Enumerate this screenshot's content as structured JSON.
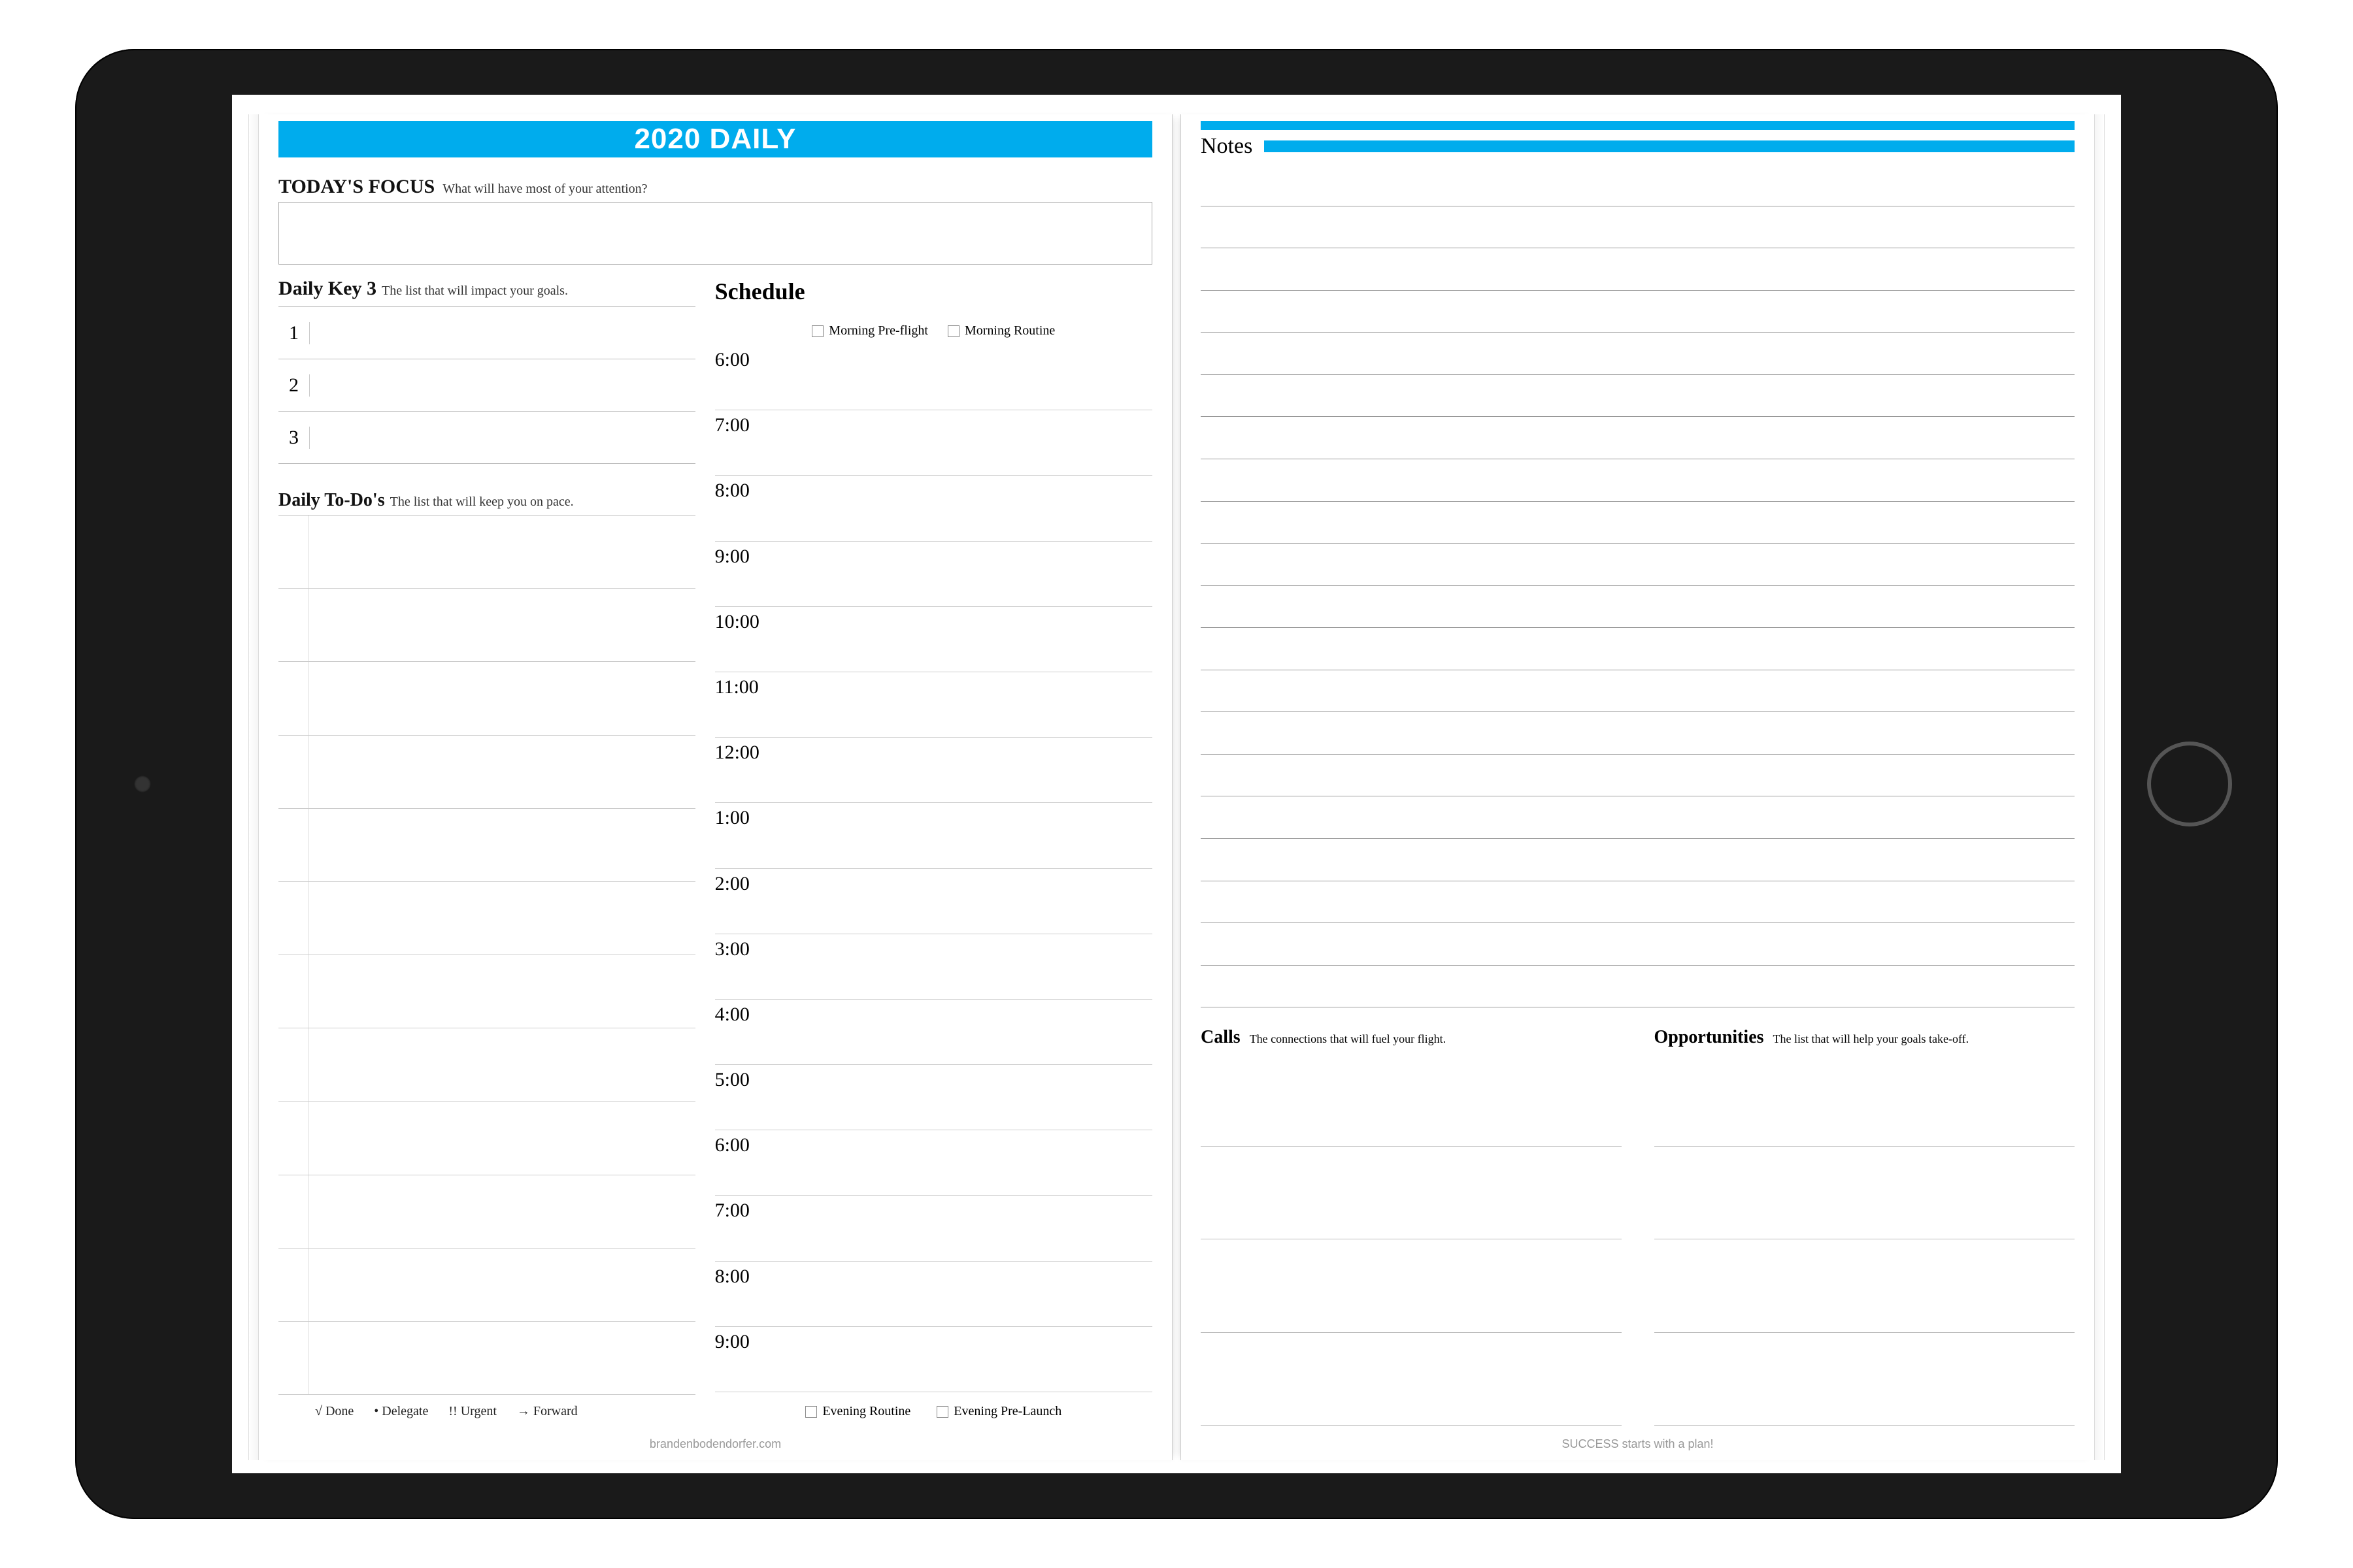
{
  "header": {
    "title": "2020 DAILY"
  },
  "focus": {
    "title": "TODAY'S FOCUS",
    "subtitle": "What will have most of your attention?"
  },
  "key3": {
    "title": "Daily Key 3",
    "subtitle": "The list that will impact your goals.",
    "items": [
      "1",
      "2",
      "3"
    ]
  },
  "todos": {
    "title": "Daily To-Do's",
    "subtitle": "The list that will keep you on pace."
  },
  "legend": {
    "done": "√ Done",
    "delegate": "• Delegate",
    "urgent": "!! Urgent",
    "forward": "→ Forward"
  },
  "schedule": {
    "title": "Schedule",
    "morning_checks": {
      "preflight": "Morning Pre-flight",
      "routine": "Morning Routine"
    },
    "times": [
      "6:00",
      "7:00",
      "8:00",
      "9:00",
      "10:00",
      "11:00",
      "12:00",
      "1:00",
      "2:00",
      "3:00",
      "4:00",
      "5:00",
      "6:00",
      "7:00",
      "8:00",
      "9:00"
    ],
    "evening_checks": {
      "routine": "Evening Routine",
      "prelaunch": "Evening Pre-Launch"
    }
  },
  "notes": {
    "title": "Notes",
    "line_count": 20
  },
  "calls": {
    "title": "Calls",
    "subtitle": "The connections that will fuel your flight."
  },
  "opportunities": {
    "title": "Opportunities",
    "subtitle": "The list that will help your goals take-off."
  },
  "footers": {
    "left": "brandenbodendorfer.com",
    "right": "SUCCESS starts with a plan!"
  },
  "colors": {
    "accent": "#00aced"
  }
}
